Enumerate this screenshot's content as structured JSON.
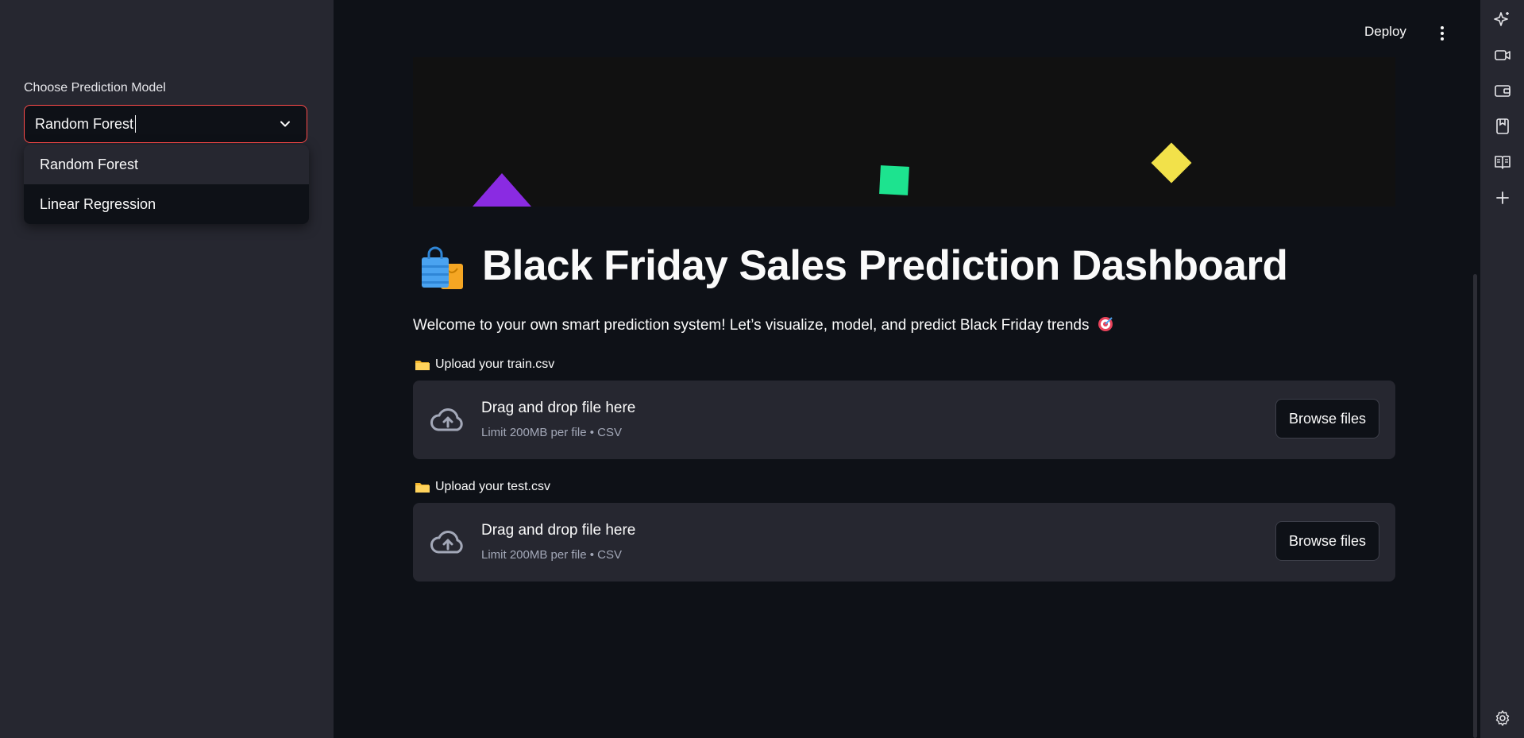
{
  "sidebar": {
    "label": "Choose Prediction Model",
    "select_value": "Random Forest",
    "options": [
      "Random Forest",
      "Linear Regression"
    ]
  },
  "header": {
    "deploy_label": "Deploy"
  },
  "main": {
    "title": "Black Friday Sales Prediction Dashboard",
    "subtitle": "Welcome to your own smart prediction system! Let’s visualize, model, and predict Black Friday trends",
    "uploads": [
      {
        "label": "Upload your train.csv",
        "title": "Drag and drop file here",
        "limit": "Limit 200MB per file • CSV",
        "button": "Browse files"
      },
      {
        "label": "Upload your test.csv",
        "title": "Drag and drop file here",
        "limit": "Limit 200MB per file • CSV",
        "button": "Browse files"
      }
    ]
  },
  "colors": {
    "accent": "#ff4b4b",
    "background": "#0e1117",
    "sidebar": "#262730"
  },
  "icons": {
    "right_toolbar": [
      "sparkle-icon",
      "video-icon",
      "wallet-icon",
      "bookmark-icon",
      "book-icon",
      "plus-icon",
      "gear-icon"
    ]
  }
}
